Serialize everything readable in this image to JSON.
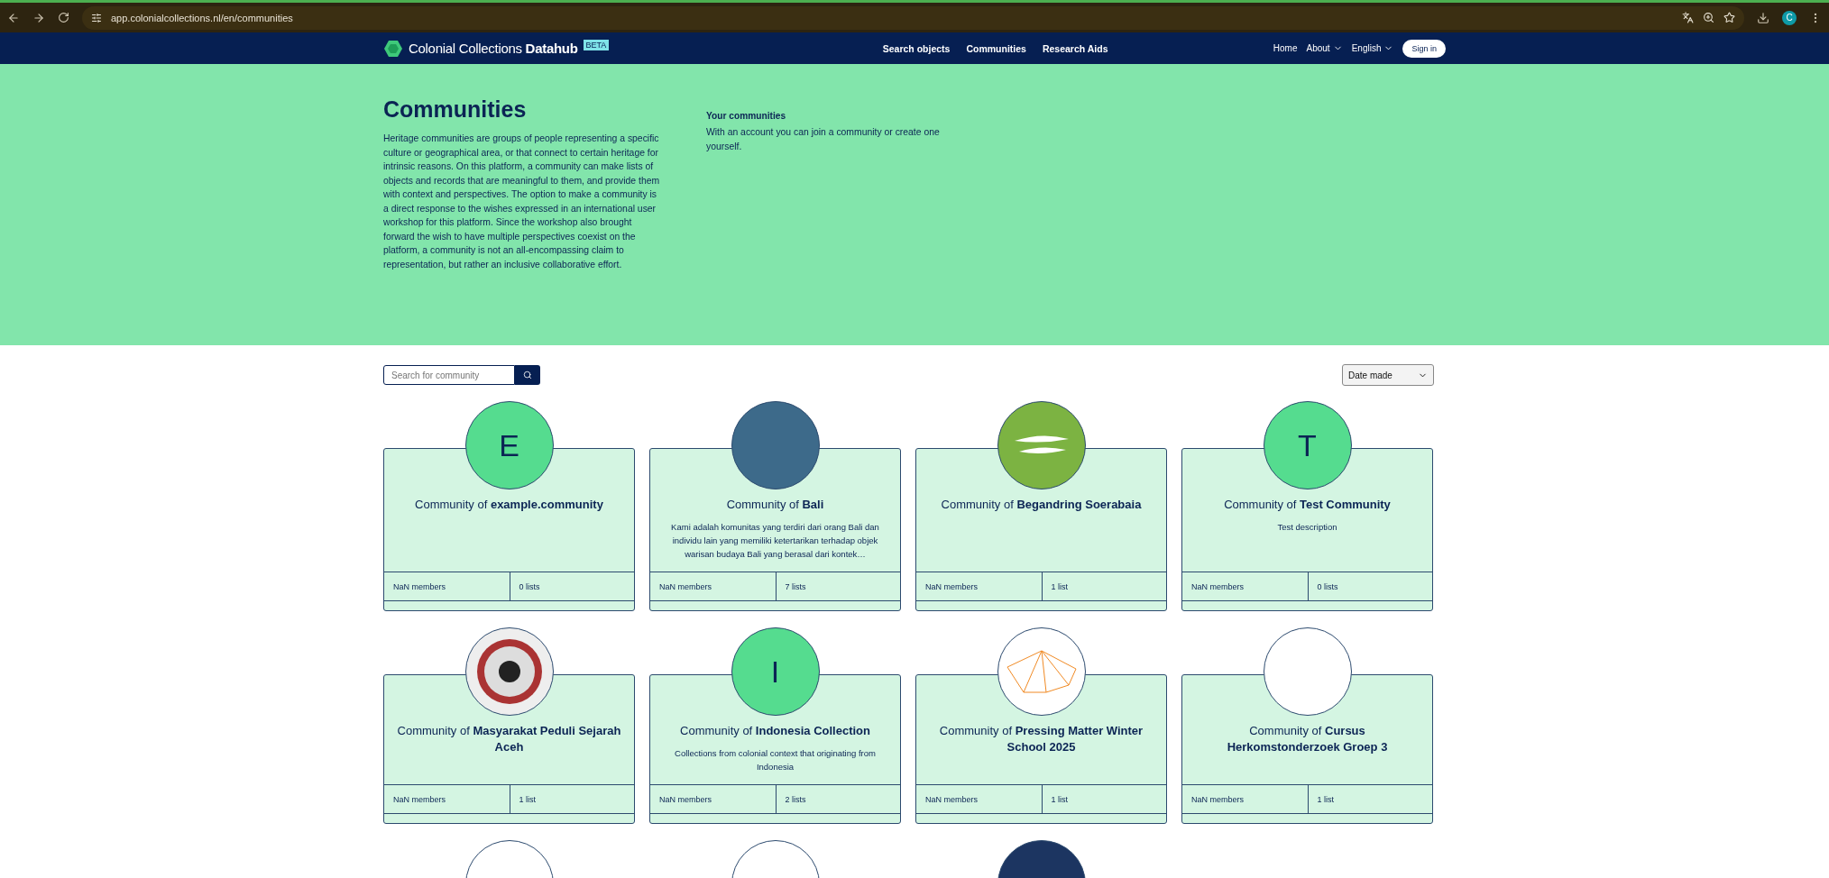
{
  "browser": {
    "url": "app.colonialcollections.nl/en/communities",
    "profile": "C"
  },
  "nav": {
    "brand": "Colonial Collections",
    "brand_bold": "Datahub",
    "badge": "BETA",
    "links": [
      "Search objects",
      "Communities",
      "Research Aids"
    ],
    "right": [
      {
        "label": "Home",
        "dropdown": false
      },
      {
        "label": "About",
        "dropdown": true
      },
      {
        "label": "English",
        "dropdown": true
      }
    ],
    "sign_in": "Sign in"
  },
  "hero": {
    "title": "Communities",
    "text": "Heritage communities are groups of people representing a specific culture or geographical area, or that connect to certain heritage for intrinsic reasons. On this platform, a community can make lists of objects and records that are meaningful to them, and provide them with context and perspectives. The option to make a community is a direct response to the wishes expressed in an international user workshop for this platform. Since the workshop also brought forward the wish to have multiple perspectives coexist on the platform, a community is not an all-encompassing claim to representation, but rather an inclusive collaborative effort.",
    "side_title": "Your communities",
    "side_text": "With an account you can join a community or create one yourself."
  },
  "search": {
    "placeholder": "Search for community"
  },
  "sort": {
    "value": "Date made"
  },
  "communities": [
    {
      "avatar": {
        "kind": "letter",
        "letter": "E"
      },
      "title": "Community of **example.community**",
      "members": "NaN members",
      "lists": "0 lists"
    },
    {
      "avatar": {
        "kind": "photo"
      },
      "title": "Community of **Bali**",
      "description": "Kami adalah komunitas yang terdiri dari orang Bali dan individu lain yang memiliki ketertarikan terhadap objek warisan budaya Bali yang berasal dari kontek…",
      "members": "NaN members",
      "lists": "7 lists"
    },
    {
      "avatar": {
        "kind": "logo"
      },
      "title": "Community of **Begandring Soerabaia**",
      "members": "NaN members",
      "lists": "1 list"
    },
    {
      "avatar": {
        "kind": "letter",
        "letter": "T"
      },
      "title": "Community of **Test Community**",
      "description": "Test description",
      "members": "NaN members",
      "lists": "0 lists"
    },
    {
      "avatar": {
        "kind": "emblem"
      },
      "title": "Community of **Masyarakat Peduli Sejarah Aceh**",
      "members": "NaN members",
      "lists": "1 list"
    },
    {
      "avatar": {
        "kind": "letter",
        "letter": "I"
      },
      "title": "Community of **Indonesia Collection**",
      "description": "Collections from colonial context that originating from Indonesia",
      "members": "NaN members",
      "lists": "2 lists"
    },
    {
      "avatar": {
        "kind": "lines"
      },
      "title": "Community of **Pressing Matter Winter School 2025**",
      "members": "NaN members",
      "lists": "1 list"
    },
    {
      "avatar": {
        "kind": "blank"
      },
      "title": "Community of **Cursus Herkomstonderzoek Groep 3**",
      "members": "NaN members",
      "lists": "1 list"
    },
    {
      "avatar": {
        "kind": "blank"
      }
    },
    {
      "avatar": {
        "kind": "blank"
      }
    },
    {
      "avatar": {
        "kind": "dark"
      }
    }
  ]
}
